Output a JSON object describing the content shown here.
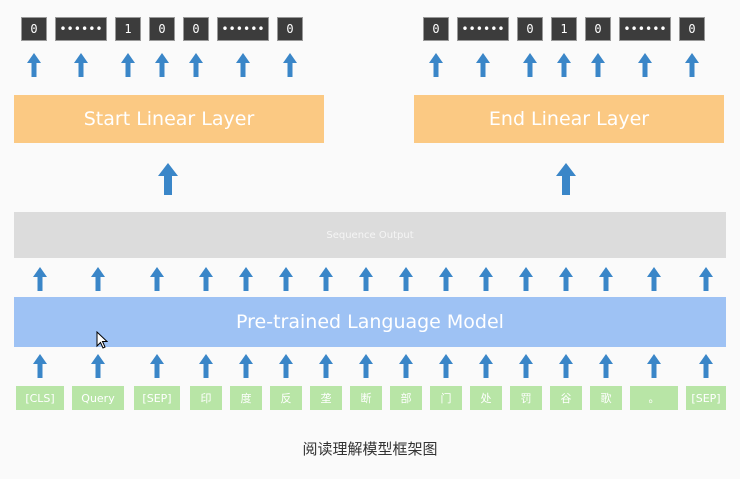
{
  "start_outputs": [
    "0",
    "••••••",
    "1",
    "0",
    "0",
    "••••••",
    "0"
  ],
  "end_outputs": [
    "0",
    "••••••",
    "0",
    "1",
    "0",
    "••••••",
    "0"
  ],
  "start_layer_label": "Start Linear Layer",
  "end_layer_label": "End Linear Layer",
  "sequence_output_label": "Sequence Output",
  "plm_label": "Pre-trained Language Model",
  "input_tokens": [
    "[CLS]",
    "Query",
    "[SEP]",
    "印",
    "度",
    "反",
    "垄",
    "断",
    "部",
    "门",
    "处",
    "罚",
    "谷",
    "歌",
    "。",
    "[SEP]"
  ],
  "caption": "阅读理解模型框架图",
  "colors": {
    "output_token_bg": "#3c3c3c",
    "linear_layer": "#fbc983",
    "sequence_output": "#dcdcdc",
    "plm": "#9ec2f4",
    "input_token": "#b8e5a6",
    "arrow": "#3a86c8"
  }
}
